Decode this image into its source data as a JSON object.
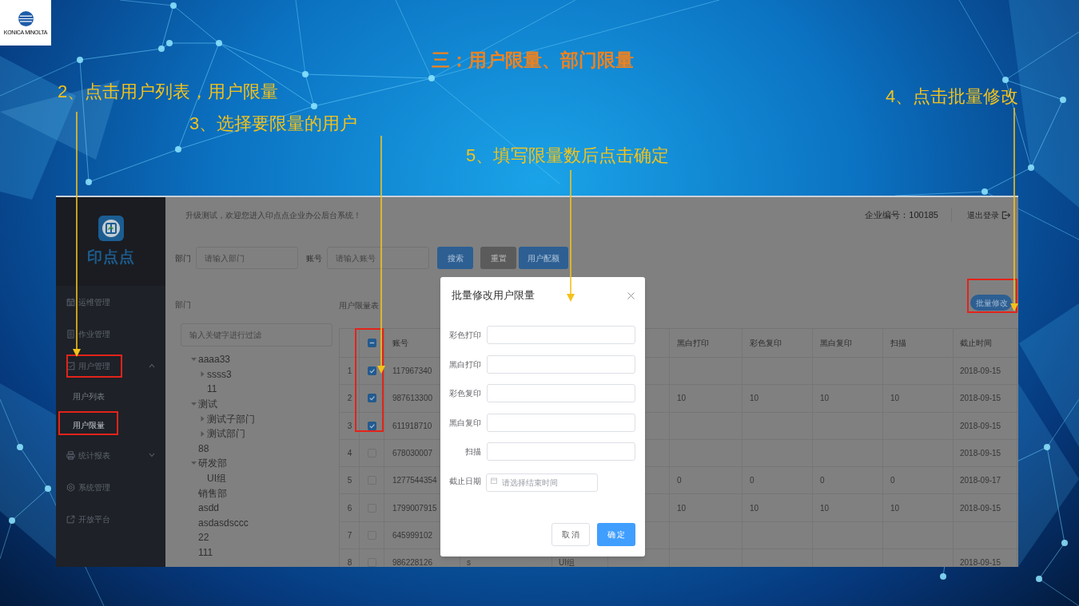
{
  "slide": {
    "logo_text": "KONICA MINOLTA",
    "title": "三：用户限量、部门限量",
    "steps": [
      "2、点击用户列表，用户限量",
      "3、选择要限量的用户",
      "5、填写限量数后点击确定",
      "4、点击批量修改"
    ]
  },
  "sidebar": {
    "brand": "印点点",
    "items": [
      {
        "label": "运维管理",
        "kind": "link"
      },
      {
        "label": "作业管理",
        "kind": "link"
      },
      {
        "label": "用户管理",
        "kind": "group",
        "expanded": true,
        "children": [
          {
            "label": "用户列表",
            "selected": false
          },
          {
            "label": "用户限量",
            "selected": true
          }
        ]
      },
      {
        "label": "统计报表",
        "kind": "group",
        "expanded": false
      },
      {
        "label": "系统管理",
        "kind": "link"
      },
      {
        "label": "开放平台",
        "kind": "link"
      }
    ]
  },
  "header": {
    "welcome": "升级测试，欢迎您进入印点点企业办公后台系统！",
    "company_id": "企业编号：100185",
    "logout": "退出登录"
  },
  "search": {
    "fields": [
      {
        "label": "部门",
        "placeholder": "请输入部门"
      },
      {
        "label": "账号",
        "placeholder": "请输入账号"
      }
    ],
    "buttons": [
      {
        "label": "搜索",
        "kind": "primary"
      },
      {
        "label": "重置",
        "kind": "default"
      },
      {
        "label": "用户配额",
        "kind": "primary"
      }
    ]
  },
  "departments": {
    "title": "部门",
    "filter_placeholder": "输入关键字进行过滤",
    "tree": [
      {
        "label": "aaaa33",
        "expanded": true,
        "children": [
          {
            "label": "ssss3",
            "expanded": false
          },
          {
            "label": "11"
          }
        ]
      },
      {
        "label": "测试",
        "expanded": true,
        "children": [
          {
            "label": "测试子部门",
            "expanded": false
          },
          {
            "label": "测试部门",
            "expanded": false
          }
        ]
      },
      {
        "label": "88"
      },
      {
        "label": "研发部",
        "expanded": true,
        "children": [
          {
            "label": "UI组"
          }
        ]
      },
      {
        "label": "销售部"
      },
      {
        "label": "asdd"
      },
      {
        "label": "asdasdsccc"
      },
      {
        "label": "22"
      },
      {
        "label": "111"
      }
    ]
  },
  "table": {
    "title": "用户限量表",
    "batch_button": "批量修改",
    "select_all": {
      "indeterminate": true
    },
    "headers": {
      "account": "账号",
      "black_print": "黑白打印",
      "color_copy": "彩色复印",
      "black_copy": "黑白复印",
      "scan": "扫描",
      "end_date": "截止时间"
    },
    "rows": [
      {
        "number": "1",
        "selected": true,
        "account": "117967340",
        "end_date": "2018-09-15"
      },
      {
        "number": "2",
        "selected": true,
        "account": "987613300",
        "black_print": "10",
        "color_copy": "10",
        "black_copy": "10",
        "scan": "10",
        "end_date": "2018-09-15"
      },
      {
        "number": "3",
        "selected": true,
        "account": "611918710",
        "end_date": "2018-09-15"
      },
      {
        "number": "4",
        "selected": false,
        "account": "678030007",
        "end_date": "2018-09-15"
      },
      {
        "number": "5",
        "selected": false,
        "account": "1277544354",
        "black_print": "0",
        "color_copy": "0",
        "black_copy": "0",
        "scan": "0",
        "end_date": "2018-09-17"
      },
      {
        "number": "6",
        "selected": false,
        "account": "1799007915",
        "black_print": "10",
        "color_copy": "10",
        "black_copy": "10",
        "scan": "10",
        "end_date": "2018-09-15"
      },
      {
        "number": "7",
        "selected": false,
        "account": "645999102"
      },
      {
        "number": "8",
        "selected": false,
        "account": "986228126",
        "column_4": "s",
        "column_5": "UI组",
        "end_date": "2018-09-15"
      }
    ]
  },
  "dialog": {
    "title": "批量修改用户限量",
    "fields": [
      {
        "label": "彩色打印",
        "kind": "number"
      },
      {
        "label": "黑白打印",
        "kind": "number"
      },
      {
        "label": "彩色复印",
        "kind": "number"
      },
      {
        "label": "黑白复印",
        "kind": "number"
      },
      {
        "label": "扫描",
        "kind": "number"
      },
      {
        "label": "截止日期",
        "kind": "date",
        "placeholder": "请选择结束时间"
      }
    ],
    "buttons": [
      {
        "label": "取 消",
        "kind": "cancel"
      },
      {
        "label": "确 定",
        "kind": "confirm"
      }
    ]
  }
}
